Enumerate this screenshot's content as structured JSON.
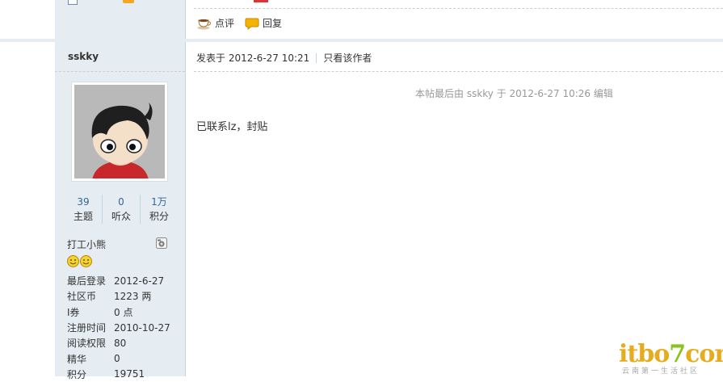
{
  "previous_post": {
    "actions": [
      {
        "icon": "comment-cup-icon",
        "label": "点评"
      },
      {
        "icon": "reply-bubble-icon",
        "label": "回复"
      }
    ]
  },
  "author": {
    "name": "sskky",
    "stats": [
      {
        "value": "39",
        "label": "主题"
      },
      {
        "value": "0",
        "label": "听众"
      },
      {
        "value": "1万",
        "label": "积分"
      }
    ],
    "rank": "打工小熊",
    "info": [
      {
        "key": "最后登录",
        "value": "2012-6-27"
      },
      {
        "key": "社区币",
        "value": "1223 两"
      },
      {
        "key": "I券",
        "value": "0 点"
      },
      {
        "key": "注册时间",
        "value": "2010-10-27"
      },
      {
        "key": "阅读权限",
        "value": "80"
      },
      {
        "key": "精华",
        "value": "0"
      },
      {
        "key": "积分",
        "value": "19751"
      }
    ]
  },
  "post": {
    "posted_at": "发表于 2012-6-27 10:21",
    "only_author_link": "只看该作者",
    "edit_note": "本帖最后由 sskky 于 2012-6-27 10:26 编辑",
    "content": "已联系lz，封贴"
  },
  "watermark": {
    "main_a": "itbo",
    "main_b": "7",
    "main_c": "com",
    "sub": "云南第一生活社区"
  },
  "colors": {
    "sidebar_bg": "#e5edf2",
    "link_blue": "#336699",
    "watermark_orange": "#e6ac1f",
    "watermark_green": "#8cc21d"
  }
}
